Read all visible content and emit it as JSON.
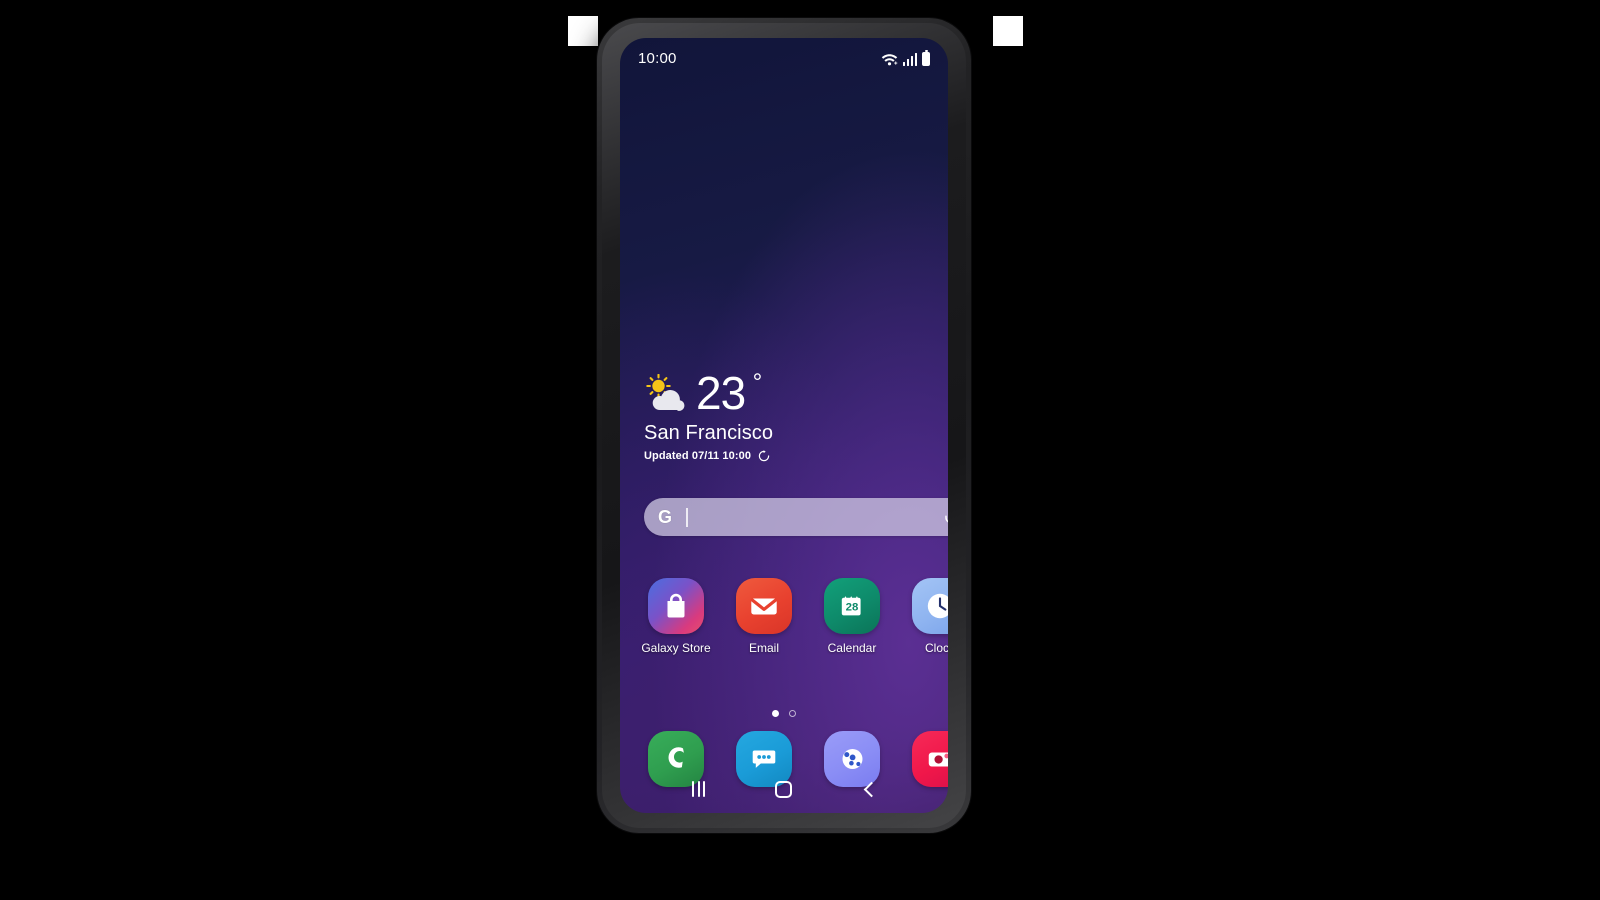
{
  "device": {
    "name": "samsung-galaxy-phone",
    "body_color": "#232325",
    "screen_bg_top": "#11153a",
    "screen_bg_bottom": "#3b1f68"
  },
  "status_bar": {
    "time": "10:00",
    "icons": [
      "wifi-icon",
      "cellular-signal-icon",
      "battery-icon"
    ]
  },
  "weather_widget": {
    "condition_icon": "sun-behind-cloud-icon",
    "temperature": "23",
    "degree_symbol": "°",
    "city": "San Francisco",
    "updated_text": "Updated 07/11 10:00",
    "refresh_icon": "refresh-icon"
  },
  "search_bar": {
    "logo": "G",
    "logo_name": "google-g-icon",
    "value": "",
    "placeholder": "",
    "mic_icon": "microphone-icon"
  },
  "app_grid": {
    "apps": [
      {
        "label": "Galaxy Store",
        "icon": "shopping-bag-icon",
        "color": "#d93a7e",
        "color2": "#4a6ee0"
      },
      {
        "label": "Email",
        "icon": "envelope-icon",
        "color": "#e8412f",
        "color2": "#e8412f"
      },
      {
        "label": "Calendar",
        "icon": "calendar-icon",
        "color": "#0e8a6a",
        "color2": "#0e8a6a",
        "day": "28"
      },
      {
        "label": "Clock",
        "icon": "clock-icon",
        "color": "#8fb4f0",
        "color2": "#8fb4f0"
      }
    ]
  },
  "page_indicator": {
    "total": 2,
    "active_index": 0
  },
  "dock": {
    "apps": [
      {
        "label": "Phone",
        "icon": "phone-handset-icon",
        "color": "#2f9e4f"
      },
      {
        "label": "Messages",
        "icon": "speech-bubble-icon",
        "color": "#1a9bd7"
      },
      {
        "label": "Internet",
        "icon": "browser-orbit-icon",
        "color": "#8a8df5"
      },
      {
        "label": "Camera",
        "icon": "camera-icon",
        "color": "#f0174a"
      }
    ]
  },
  "nav_bar": {
    "recents_label": "Recents",
    "home_label": "Home",
    "back_label": "Back"
  }
}
